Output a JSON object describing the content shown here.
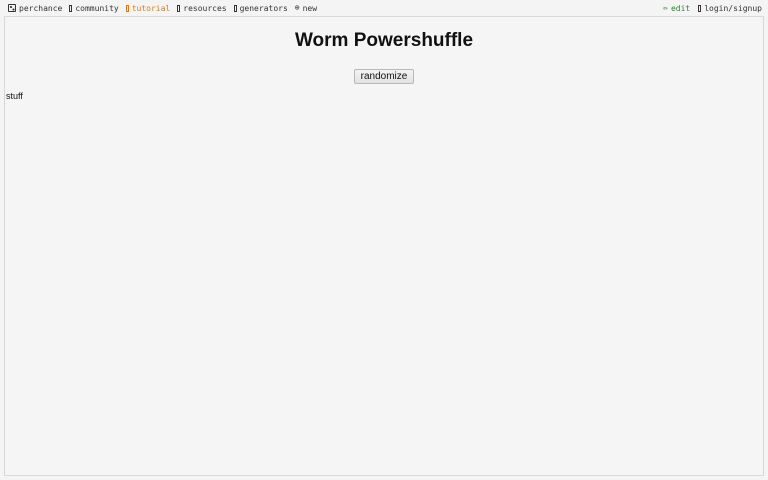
{
  "nav": {
    "left": [
      {
        "label": "perchance",
        "icon": "dice-icon"
      },
      {
        "label": "community",
        "icon": "community-icon"
      },
      {
        "label": "tutorial",
        "icon": "tutorial-icon",
        "active": true
      },
      {
        "label": "resources",
        "icon": "resources-icon"
      },
      {
        "label": "generators",
        "icon": "generators-icon"
      },
      {
        "label": "new",
        "icon": "plus-circle-icon"
      }
    ],
    "right": [
      {
        "label": "edit",
        "icon": "pencil-icon"
      },
      {
        "label": "login/signup",
        "icon": "login-icon"
      }
    ],
    "colors": {
      "active": "#e07a18",
      "edit": "#2a8a2a",
      "text": "#333333"
    }
  },
  "page": {
    "title": "Worm Powershuffle",
    "randomize_label": "randomize",
    "output_text": "stuff"
  }
}
